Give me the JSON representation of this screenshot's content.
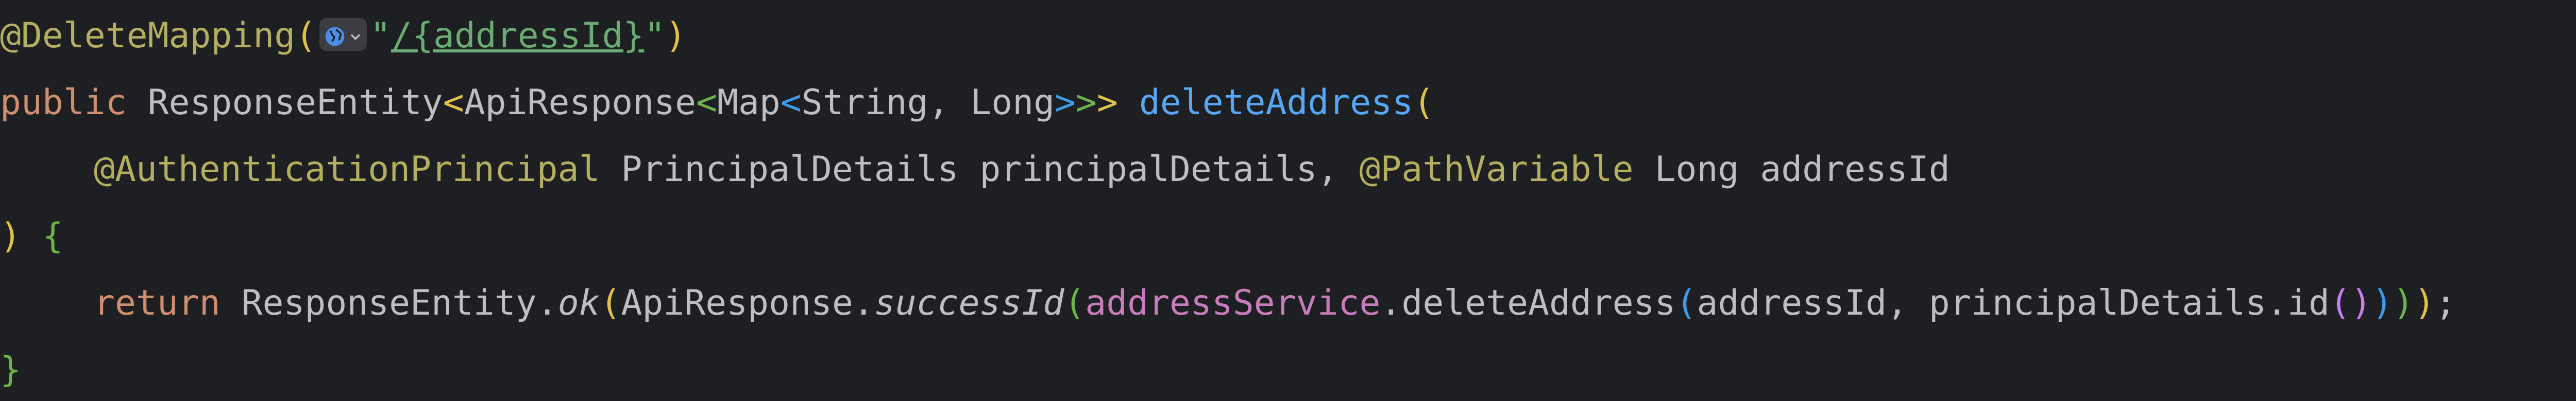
{
  "code": {
    "line1": {
      "annotation": "@DeleteMapping",
      "open_paren": "(",
      "quote_open": "\"",
      "path": "/{addressId}",
      "quote_close": "\"",
      "close_paren": ")",
      "inlay_icon": "globe-icon"
    },
    "line2": {
      "kw_public": "public",
      "type_response_entity": "ResponseEntity",
      "lt1": "<",
      "type_api_response": "ApiResponse",
      "lt2": "<",
      "type_map": "Map",
      "lt3": "<",
      "type_string": "String",
      "comma": ", ",
      "type_long": "Long",
      "gt3": ">",
      "gt2": ">",
      "gt1": ">",
      "method_name": "deleteAddress",
      "open_paren": "("
    },
    "line3": {
      "ann_auth": "@AuthenticationPrincipal",
      "type_principal": "PrincipalDetails",
      "param_principal": "principalDetails",
      "comma": ", ",
      "ann_path": "@PathVariable",
      "type_long": "Long",
      "param_address": "addressId"
    },
    "line4": {
      "close_paren": ")",
      "open_brace": "{"
    },
    "line5": {
      "kw_return": "return",
      "cls_response_entity": "ResponseEntity",
      "dot1": ".",
      "method_ok": "ok",
      "p1_open": "(",
      "cls_api_response": "ApiResponse",
      "dot2": ".",
      "method_success": "successId",
      "p2_open": "(",
      "field_service": "addressService",
      "dot3": ".",
      "method_delete": "deleteAddress",
      "p3_open": "(",
      "arg_address": "addressId",
      "comma": ", ",
      "arg_principal": "principalDetails",
      "dot4": ".",
      "method_id": "id",
      "p4_open": "(",
      "p4_close": ")",
      "p3_close": ")",
      "p2_close": ")",
      "p1_close": ")",
      "semicolon": ";"
    },
    "line6": {
      "close_brace": "}"
    }
  }
}
